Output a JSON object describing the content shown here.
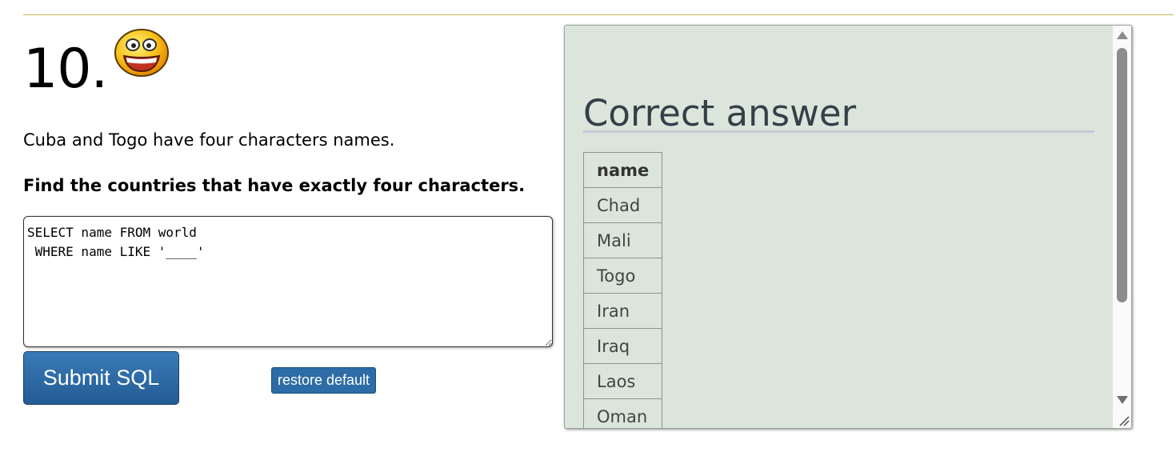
{
  "question": {
    "number": "10.",
    "icon": "smiley-icon",
    "intro": "Cuba and Togo have four characters names.",
    "task": "Find the countries that have exactly four characters."
  },
  "editor": {
    "value": "SELECT name FROM world\n WHERE name LIKE '____'"
  },
  "buttons": {
    "submit_label": "Submit SQL",
    "restore_label": "restore default"
  },
  "answer": {
    "title": "Correct answer",
    "columns": [
      "name"
    ],
    "rows": [
      "Chad",
      "Mali",
      "Togo",
      "Iran",
      "Iraq",
      "Laos",
      "Oman"
    ]
  },
  "colors": {
    "panel_background": "#dbe5db",
    "button_blue": "#2d6ca6",
    "rule_gold": "#c9b458"
  }
}
